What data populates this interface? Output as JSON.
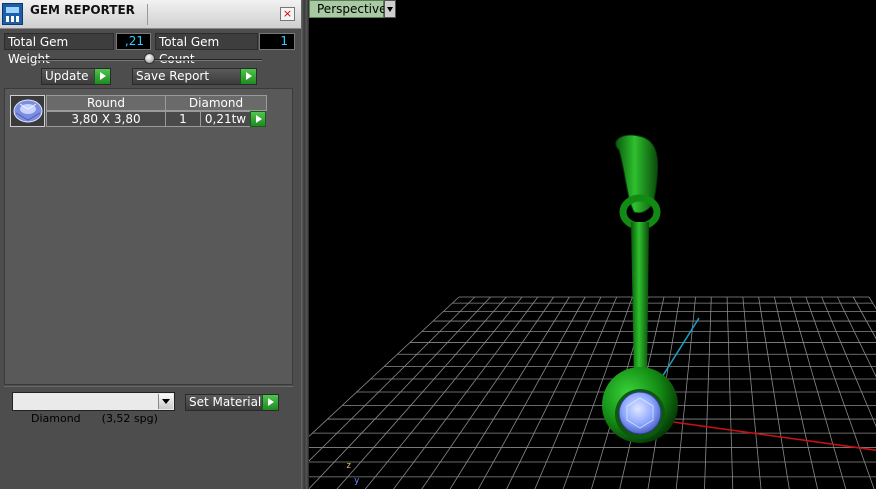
{
  "panel": {
    "title": "GEM REPORTER",
    "close_glyph": "×",
    "app_icon": "report-icon",
    "total_weight_label": "Total Gem Weight",
    "total_weight_value": ",21",
    "total_count_label": "Total Gem Count",
    "total_count_value": "1",
    "update_label": "Update",
    "save_report_label": "Save Report",
    "table": {
      "headers": [
        "Round",
        "Diamond"
      ],
      "rows": [
        {
          "size": "3,80 X 3,80",
          "count": "1",
          "weight": "0,21tw"
        }
      ]
    },
    "material_select": "Diamond      (3,52 spg)",
    "set_material_label": "Set Material"
  },
  "viewport": {
    "tab_label": "Perspective",
    "axis_z": "z",
    "axis_y": "y"
  },
  "colors": {
    "pendant_green": "#1a9a1a",
    "grid": "#8a8a8a",
    "x_axis": "#d01010",
    "y_axis": "#1aa0c8",
    "gem": "#9fb8ff",
    "value_cyan": "#2ad0ff"
  }
}
